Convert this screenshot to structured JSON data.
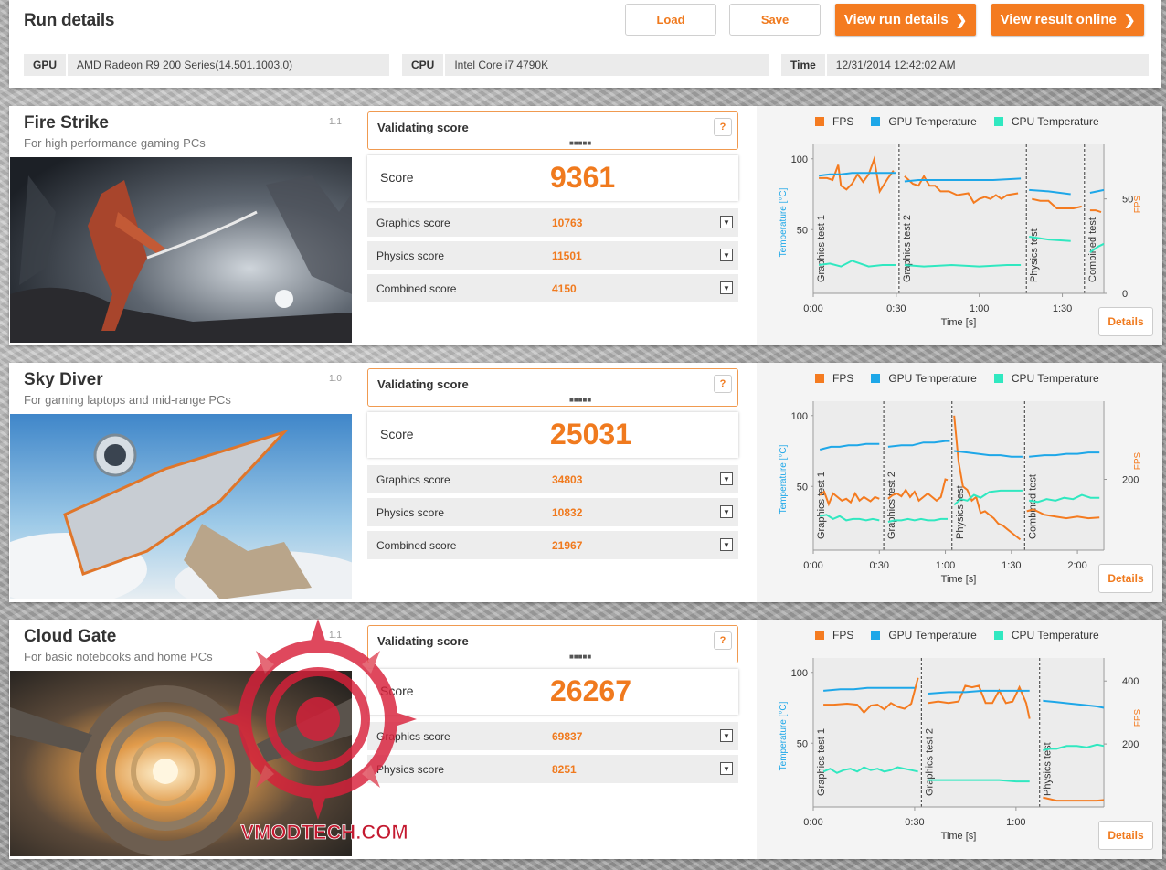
{
  "header": {
    "title": "Run details",
    "load_label": "Load",
    "save_label": "Save",
    "view_run_label": "View run details",
    "view_online_label": "View result online",
    "gpu_label": "GPU",
    "gpu_value": "AMD Radeon R9 200 Series(14.501.1003.0)",
    "cpu_label": "CPU",
    "cpu_value": "Intel Core i7 4790K",
    "time_label": "Time",
    "time_value": "12/31/2014 12:42:02 AM",
    "chevron_icon": "chevron-right-icon"
  },
  "common": {
    "validating": "Validating score",
    "help": "?",
    "dots": "■■■■■",
    "score_label": "Score",
    "details_label": "Details",
    "legend_fps": "FPS",
    "legend_gpu": "GPU Temperature",
    "legend_cpu": "CPU Temperature",
    "ylabel_temp": "Temperature [°C]",
    "ylabel_fps": "FPS",
    "xlabel": "Time [s]",
    "colors": {
      "fps": "#f47b20",
      "gpu": "#1ea7e8",
      "cpu": "#30e8c0",
      "accent": "#f07a1e"
    }
  },
  "benchmarks": [
    {
      "name": "Fire Strike",
      "version": "1.1",
      "description": "For high performance gaming PCs",
      "score": "9361",
      "subscores": [
        {
          "label": "Graphics score",
          "value": "10763"
        },
        {
          "label": "Physics score",
          "value": "11501"
        },
        {
          "label": "Combined score",
          "value": "4150"
        }
      ]
    },
    {
      "name": "Sky Diver",
      "version": "1.0",
      "description": "For gaming laptops and mid-range PCs",
      "score": "25031",
      "subscores": [
        {
          "label": "Graphics score",
          "value": "34803"
        },
        {
          "label": "Physics score",
          "value": "10832"
        },
        {
          "label": "Combined score",
          "value": "21967"
        }
      ]
    },
    {
      "name": "Cloud Gate",
      "version": "1.1",
      "description": "For basic notebooks and home PCs",
      "score": "26267",
      "subscores": [
        {
          "label": "Graphics score",
          "value": "69837"
        },
        {
          "label": "Physics score",
          "value": "8251"
        }
      ]
    }
  ],
  "chart_data": [
    {
      "type": "line",
      "xlabel": "Time [s]",
      "ylabel": "Temperature [°C]",
      "y2label": "FPS",
      "xlim": [
        0,
        105
      ],
      "ylim": [
        5,
        105
      ],
      "y2lim": [
        0,
        75
      ],
      "x_ticks": [
        "0:00",
        "0:30",
        "1:00",
        "1:30"
      ],
      "x_tick_values": [
        0,
        30,
        60,
        90
      ],
      "y_ticks": [
        50,
        100
      ],
      "y2_ticks": [
        0,
        50
      ],
      "segments": [
        {
          "label": "Graphics test 1",
          "start": 0,
          "end": 30
        },
        {
          "label": "Graphics test 2",
          "start": 31,
          "end": 77
        },
        {
          "label": "Physics test",
          "start": 77,
          "end": 98
        },
        {
          "label": "Combined test",
          "start": 98,
          "end": 105
        }
      ],
      "series": [
        {
          "name": "FPS",
          "axis": "y2",
          "x": [
            2,
            5,
            7,
            9,
            10,
            12,
            14,
            16,
            18,
            20,
            22,
            24,
            27,
            29,
            33,
            36,
            38,
            40,
            42,
            44,
            46,
            49,
            52,
            56,
            58,
            60,
            62,
            64,
            66,
            68,
            70,
            74,
            79,
            82,
            85,
            88,
            90,
            94,
            97,
            100,
            102,
            104
          ],
          "values": [
            61,
            61,
            60,
            68,
            57,
            55,
            58,
            63,
            59,
            63,
            71,
            54,
            61,
            65,
            62,
            58,
            57,
            62,
            57,
            57,
            54,
            54,
            52,
            53,
            48,
            50,
            51,
            50,
            52,
            50,
            52,
            53,
            50,
            49,
            49,
            45,
            45,
            45,
            46,
            44,
            44,
            43
          ]
        },
        {
          "name": "GPU Temperature",
          "axis": "y",
          "x": [
            2,
            6,
            10,
            14,
            20,
            25,
            30,
            33,
            38,
            45,
            55,
            65,
            75,
            78,
            85,
            93,
            100,
            105
          ],
          "values": [
            88,
            89,
            89,
            90,
            90,
            90,
            90,
            84,
            85,
            85,
            85,
            85,
            86,
            78,
            77,
            75,
            76,
            78
          ]
        },
        {
          "name": "CPU Temperature",
          "axis": "y",
          "x": [
            2,
            6,
            10,
            14,
            20,
            25,
            30,
            33,
            40,
            50,
            60,
            70,
            75,
            78,
            85,
            93,
            100,
            103,
            105
          ],
          "values": [
            25,
            26,
            24,
            28,
            24,
            25,
            25,
            25,
            24,
            25,
            24,
            25,
            25,
            45,
            43,
            42,
            34,
            38,
            40
          ]
        }
      ]
    },
    {
      "type": "line",
      "xlabel": "Time [s]",
      "ylabel": "Temperature [°C]",
      "y2label": "FPS",
      "xlim": [
        0,
        132
      ],
      "ylim": [
        5,
        105
      ],
      "y2lim": [
        0,
        400
      ],
      "x_ticks": [
        "0:00",
        "0:30",
        "1:00",
        "1:30",
        "2:00"
      ],
      "x_tick_values": [
        0,
        30,
        60,
        90,
        120
      ],
      "y_ticks": [
        50,
        100
      ],
      "y2_ticks": [
        200
      ],
      "segments": [
        {
          "label": "Graphics test 1",
          "start": 0,
          "end": 32
        },
        {
          "label": "Graphics test 2",
          "start": 32,
          "end": 63
        },
        {
          "label": "Physics test",
          "start": 63,
          "end": 96
        },
        {
          "label": "Combined test",
          "start": 96,
          "end": 132
        }
      ],
      "series": [
        {
          "name": "FPS",
          "axis": "y2",
          "x": [
            3,
            5,
            7,
            9,
            11,
            13,
            15,
            17,
            19,
            21,
            23,
            26,
            28,
            30,
            34,
            36,
            38,
            40,
            42,
            44,
            46,
            48,
            50,
            52,
            54,
            56,
            58,
            60,
            61,
            64,
            66,
            68,
            70,
            72,
            74,
            76,
            78,
            80,
            82,
            84,
            86,
            88,
            90,
            92,
            94,
            97,
            100,
            105,
            110,
            115,
            120,
            125,
            130
          ],
          "values": [
            155,
            165,
            130,
            160,
            150,
            140,
            145,
            135,
            160,
            140,
            150,
            138,
            150,
            145,
            145,
            155,
            160,
            152,
            170,
            150,
            165,
            140,
            150,
            160,
            150,
            140,
            150,
            200,
            198,
            380,
            250,
            180,
            170,
            140,
            150,
            105,
            110,
            100,
            90,
            75,
            70,
            60,
            50,
            40,
            30,
            110,
            115,
            100,
            95,
            90,
            95,
            90,
            92
          ]
        },
        {
          "name": "GPU Temperature",
          "axis": "y",
          "x": [
            3,
            8,
            12,
            16,
            20,
            24,
            28,
            30,
            34,
            40,
            45,
            50,
            55,
            60,
            62,
            64,
            70,
            75,
            80,
            85,
            90,
            95,
            98,
            105,
            110,
            115,
            120,
            125,
            130
          ],
          "values": [
            76,
            78,
            78,
            79,
            79,
            80,
            80,
            80,
            78,
            79,
            79,
            81,
            81,
            82,
            82,
            75,
            74,
            73,
            72,
            72,
            71,
            71,
            71,
            72,
            72,
            73,
            73,
            74,
            74
          ]
        },
        {
          "name": "CPU Temperature",
          "axis": "y",
          "x": [
            3,
            6,
            9,
            12,
            15,
            18,
            21,
            24,
            27,
            30,
            34,
            37,
            40,
            43,
            46,
            49,
            52,
            55,
            58,
            61,
            64,
            67,
            70,
            73,
            76,
            80,
            85,
            90,
            95,
            98,
            102,
            106,
            110,
            114,
            118,
            122,
            126,
            130
          ],
          "values": [
            29,
            30,
            27,
            29,
            26,
            27,
            27,
            26,
            27,
            26,
            25,
            26,
            26,
            27,
            26,
            27,
            26,
            26,
            27,
            27,
            37,
            41,
            40,
            44,
            42,
            46,
            47,
            47,
            47,
            40,
            39,
            41,
            40,
            42,
            41,
            44,
            42,
            42
          ]
        }
      ]
    },
    {
      "type": "line",
      "xlabel": "Time [s]",
      "ylabel": "Temperature [°C]",
      "y2label": "FPS",
      "xlim": [
        0,
        86
      ],
      "ylim": [
        5,
        105
      ],
      "y2lim": [
        0,
        450
      ],
      "x_ticks": [
        "0:00",
        "0:30",
        "1:00"
      ],
      "x_tick_values": [
        0,
        30,
        60
      ],
      "y_ticks": [
        50,
        100
      ],
      "y2_ticks": [
        200,
        400
      ],
      "segments": [
        {
          "label": "Graphics test 1",
          "start": 0,
          "end": 32
        },
        {
          "label": "Graphics test 2",
          "start": 32,
          "end": 67
        },
        {
          "label": "Physics test",
          "start": 67,
          "end": 86
        }
      ],
      "series": [
        {
          "name": "FPS",
          "axis": "y2",
          "x": [
            3,
            6,
            10,
            13,
            15,
            17,
            19,
            21,
            23,
            25,
            27,
            29,
            31,
            34,
            37,
            40,
            43,
            45,
            47,
            49,
            51,
            53,
            55,
            57,
            59,
            61,
            63,
            64,
            68,
            70,
            72,
            75,
            78,
            81,
            84,
            86
          ],
          "values": [
            325,
            325,
            328,
            325,
            300,
            322,
            325,
            310,
            330,
            318,
            312,
            328,
            410,
            330,
            335,
            330,
            335,
            385,
            380,
            385,
            330,
            330,
            370,
            330,
            335,
            380,
            330,
            280,
            30,
            25,
            20,
            20,
            20,
            20,
            20,
            22
          ]
        },
        {
          "name": "GPU Temperature",
          "axis": "y",
          "x": [
            3,
            8,
            12,
            16,
            20,
            25,
            30,
            34,
            40,
            45,
            50,
            55,
            60,
            64,
            68,
            72,
            76,
            80,
            84,
            86
          ],
          "values": [
            87,
            88,
            88,
            89,
            89,
            89,
            89,
            85,
            86,
            86,
            87,
            87,
            87,
            87,
            80,
            79,
            78,
            77,
            76,
            75
          ]
        },
        {
          "name": "CPU Temperature",
          "axis": "y",
          "x": [
            3,
            5,
            7,
            9,
            11,
            13,
            15,
            17,
            19,
            21,
            23,
            25,
            27,
            29,
            31,
            34,
            40,
            45,
            50,
            55,
            60,
            64,
            68,
            70,
            72,
            75,
            78,
            81,
            84,
            86
          ],
          "values": [
            30,
            32,
            29,
            31,
            32,
            30,
            33,
            31,
            32,
            30,
            31,
            33,
            32,
            31,
            30,
            24,
            24,
            24,
            24,
            24,
            23,
            23,
            45,
            46,
            46,
            48,
            48,
            47,
            49,
            48
          ]
        }
      ]
    }
  ]
}
